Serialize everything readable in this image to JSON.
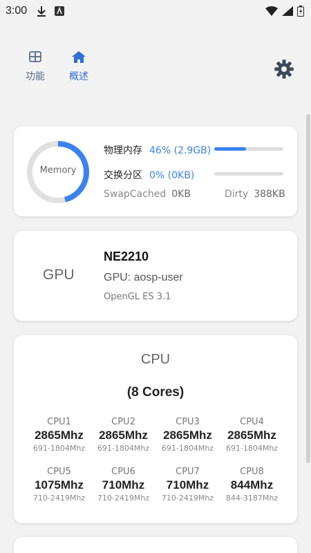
{
  "status": {
    "time": "3:00"
  },
  "nav": {
    "tabs": [
      {
        "label": "功能",
        "icon": "grid-icon"
      },
      {
        "label": "概述",
        "icon": "home-icon"
      }
    ],
    "settings_icon": "gear-icon"
  },
  "memory": {
    "ring_label": "Memory",
    "ring_percent": 46,
    "physical": {
      "label": "物理内存",
      "value": "46% (2.9GB)",
      "fill_percent": 46
    },
    "swap": {
      "label": "交换分区",
      "value": "0% (0KB)",
      "fill_percent": 0
    },
    "swap_cached": {
      "label": "SwapCached",
      "value": "0KB"
    },
    "dirty": {
      "label": "Dirty",
      "value": "388KB"
    }
  },
  "gpu": {
    "heading": "GPU",
    "model": "NE2210",
    "name": "GPU: aosp-user",
    "opengl": "OpenGL ES 3.1"
  },
  "cpu": {
    "heading": "CPU",
    "cores": "(8 Cores)",
    "items": [
      {
        "name": "CPU1",
        "freq": "2865Mhz",
        "range": "691-1804Mhz"
      },
      {
        "name": "CPU2",
        "freq": "2865Mhz",
        "range": "691-1804Mhz"
      },
      {
        "name": "CPU3",
        "freq": "2865Mhz",
        "range": "691-1804Mhz"
      },
      {
        "name": "CPU4",
        "freq": "2865Mhz",
        "range": "691-1804Mhz"
      },
      {
        "name": "CPU5",
        "freq": "1075Mhz",
        "range": "710-2419Mhz"
      },
      {
        "name": "CPU6",
        "freq": "710Mhz",
        "range": "710-2419Mhz"
      },
      {
        "name": "CPU7",
        "freq": "710Mhz",
        "range": "710-2419Mhz"
      },
      {
        "name": "CPU8",
        "freq": "844Mhz",
        "range": "844-3187Mhz"
      }
    ]
  },
  "colors": {
    "accent": "#3a82f0",
    "ring_track": "#e0e0e0"
  }
}
